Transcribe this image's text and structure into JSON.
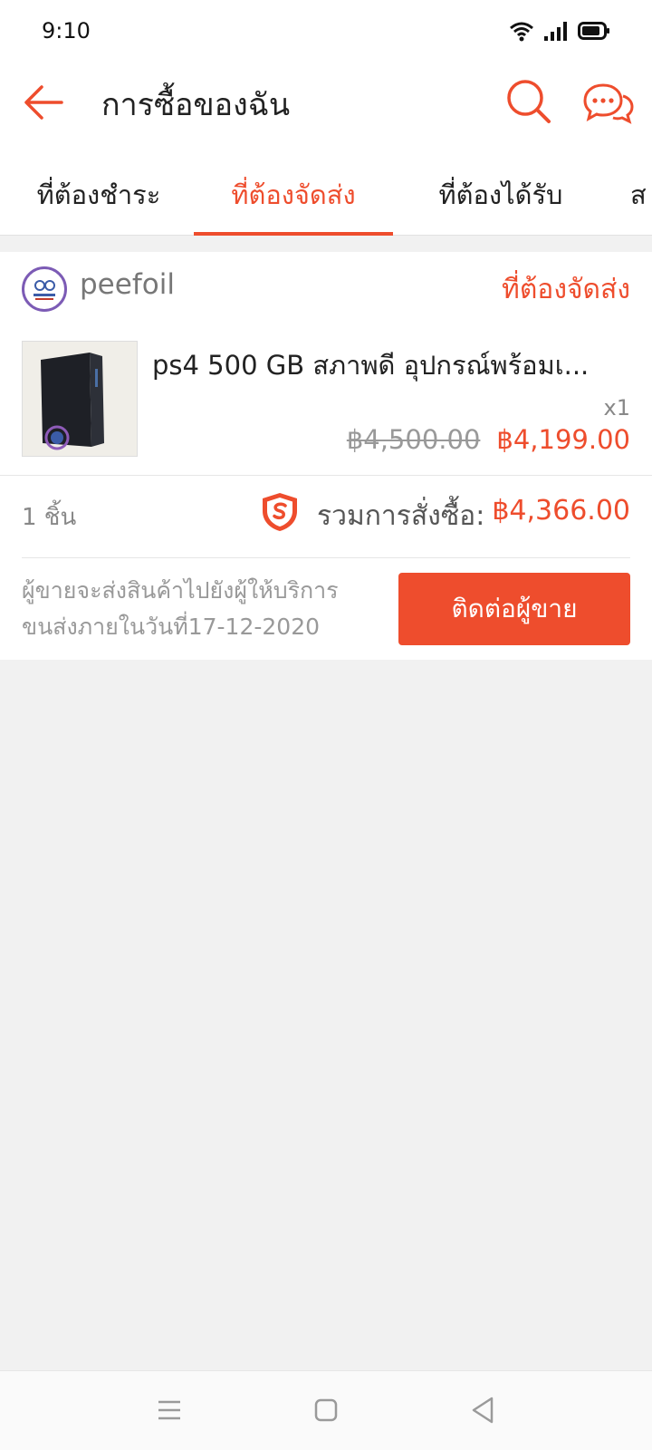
{
  "status_bar": {
    "time": "9:10",
    "icons": [
      "wifi-icon",
      "signal-icon",
      "battery-icon"
    ]
  },
  "app_bar": {
    "title": "การซื้อของฉัน",
    "icons": [
      "back-arrow-icon",
      "search-icon",
      "chat-icon"
    ]
  },
  "tabs": [
    {
      "label": "ที่ต้องชำระ",
      "active": false
    },
    {
      "label": "ที่ต้องจัดส่ง",
      "active": true
    },
    {
      "label": "ที่ต้องได้รับ",
      "active": false
    },
    {
      "label": "ส",
      "active": false
    }
  ],
  "order": {
    "shop_name": "peefoil",
    "status": "ที่ต้องจัดส่ง",
    "product_name": "ps4  500 GB สภาพดี อุปกรณ์พร้อมเ...",
    "quantity": "x1",
    "price_original": "฿4,500.00",
    "price_final": "฿4,199.00",
    "item_count": "1 ชิ้น",
    "total_label": "รวมการสั่งซื้อ:",
    "total_amount": "฿4,366.00",
    "ship_note_line1": "ผู้ขายจะส่งสินค้าไปยังผู้ให้บริการ",
    "ship_note_line2": "ขนส่งภายในวันที่17-12-2020",
    "contact_button": "ติดต่อผู้ขาย"
  },
  "colors": {
    "accent": "#ee4d2d",
    "background": "#f1f1f1"
  }
}
